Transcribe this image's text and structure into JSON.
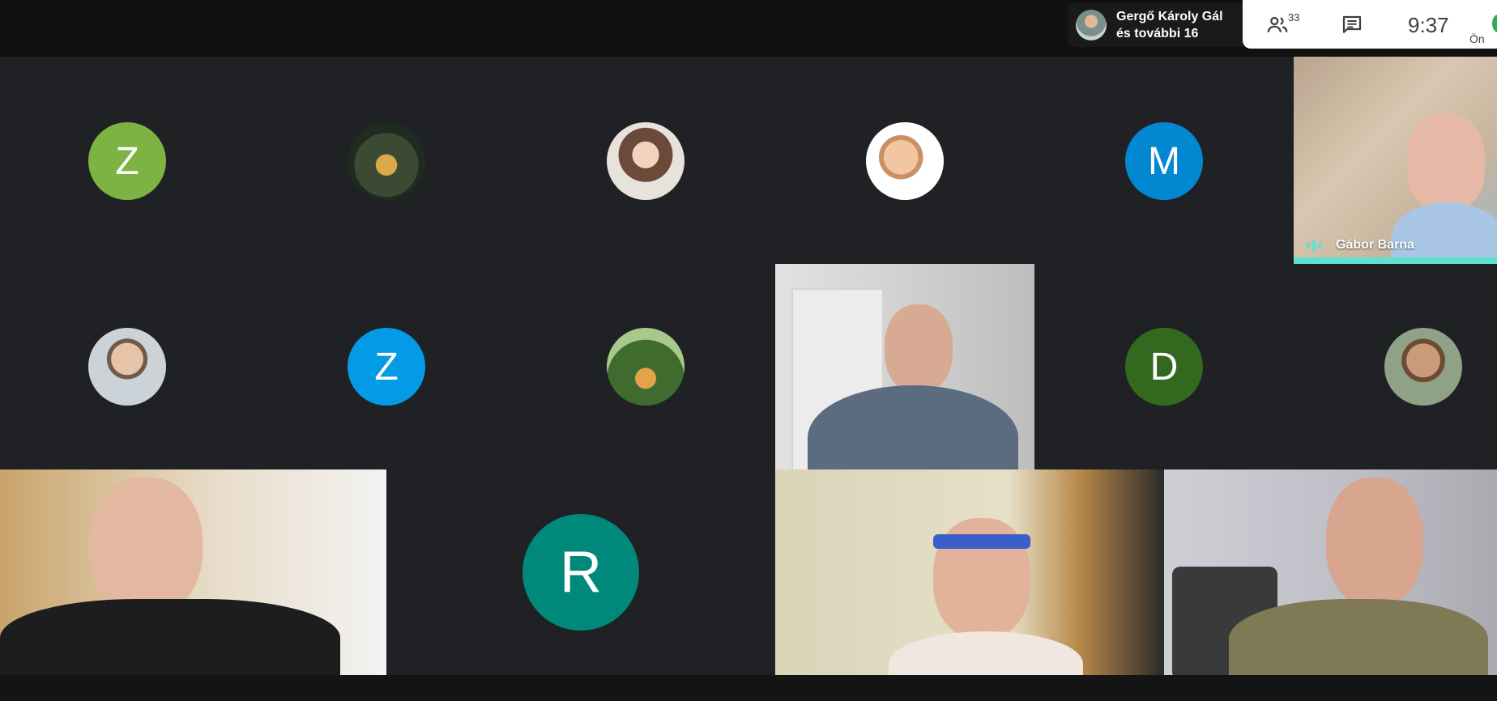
{
  "presenter": {
    "name": "Gergő Károly Gál",
    "others": "és további 16"
  },
  "toolbar": {
    "people_icon": "people-icon",
    "participant_count": "33",
    "chat_icon": "chat-icon",
    "time": "9:37",
    "self_label": "Ön"
  },
  "avatars": [
    {
      "letter": "Z",
      "color": "#7cb342"
    },
    {
      "letter": "",
      "kind": "photo"
    },
    {
      "letter": "",
      "kind": "photo"
    },
    {
      "letter": "",
      "kind": "photo"
    },
    {
      "letter": "M",
      "color": "#0288d1"
    },
    {
      "letter": "",
      "kind": "photo"
    },
    {
      "letter": "Z",
      "color": "#039be5"
    },
    {
      "letter": "",
      "kind": "photo"
    },
    {
      "letter": "D",
      "color": "#33691e"
    },
    {
      "letter": "",
      "kind": "photo"
    },
    {
      "letter": "R",
      "color": "#00897b"
    }
  ],
  "active_speaker": {
    "name": "Gábor Barna",
    "accent": "#5ee2d0"
  }
}
